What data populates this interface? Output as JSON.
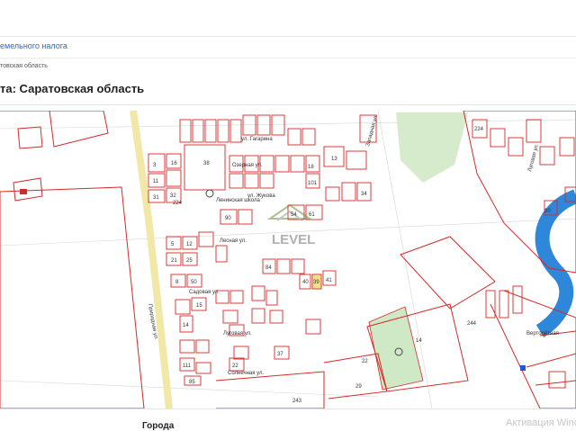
{
  "nav": {
    "link": "емельного налога"
  },
  "breadcrumb": "товская область",
  "page_title": "та: Саратовская область",
  "map": {
    "colors": {
      "boundary": "#d42a2a",
      "greenery": "#cfe8c6",
      "river": "#2f87d9",
      "road": "#f1e7a6",
      "cadastral": "#c8c8c8"
    },
    "watermark": "LEVEL",
    "streets": {
      "prirodnaya": "Природная ул.",
      "lenskaya_school": "Ленинская школа",
      "zhukova": "ул. Жукова",
      "gagarina": "ул. Гагарина",
      "lesnaya": "Лесная ул.",
      "lugovaya": "Луговая ул.",
      "lugovaya_right": "Луговая ул.",
      "solnechnaya": "Солнечная ул.",
      "vertoletnaya": "Вертолётная",
      "sadovaya": "Садовая ул.",
      "ozernaya": "Озерная ул.",
      "zapadnaya": "Западная ул."
    },
    "plots": {
      "p38": "38",
      "p3": "3",
      "p13": "13",
      "p16": "16",
      "p11": "11",
      "p31": "31",
      "p32": "32",
      "p224a": "224",
      "p18": "18",
      "p101": "101",
      "p34": "34",
      "p90": "90",
      "p54": "54",
      "p61": "61",
      "p84": "84",
      "p5": "5",
      "p12": "12",
      "p21": "21",
      "p25": "25",
      "p8": "8",
      "p50": "50",
      "p15": "15",
      "p14a": "14",
      "p111": "111",
      "p85": "85",
      "p22": "22",
      "p37": "37",
      "p40": "40",
      "p39": "39",
      "p41": "41",
      "p244": "244",
      "p14b": "14",
      "p243": "243",
      "p29": "29",
      "p22r": "22",
      "p224r": "224",
      "p30": "30"
    }
  },
  "footer": {
    "section_heading": "Города",
    "activation": "Активация Windows"
  }
}
